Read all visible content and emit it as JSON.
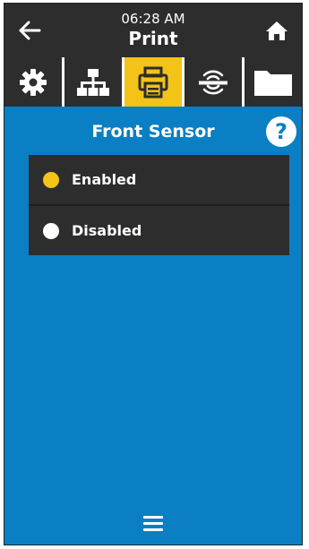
{
  "header": {
    "time": "06:28 AM",
    "title": "Print"
  },
  "tabs": [
    {
      "name": "settings",
      "icon": "gear-icon",
      "active": false
    },
    {
      "name": "network",
      "icon": "network-icon",
      "active": false
    },
    {
      "name": "print",
      "icon": "printer-icon",
      "active": true
    },
    {
      "name": "rfid",
      "icon": "rfid-icon",
      "active": false
    },
    {
      "name": "storage",
      "icon": "folder-icon",
      "active": false
    }
  ],
  "section": {
    "title": "Front Sensor",
    "help_symbol": "?"
  },
  "options": [
    {
      "label": "Enabled",
      "selected": true
    },
    {
      "label": "Disabled",
      "selected": false
    }
  ],
  "colors": {
    "accent": "#f3c317",
    "background": "#0a7fc4",
    "dark": "#2d2d2d"
  }
}
